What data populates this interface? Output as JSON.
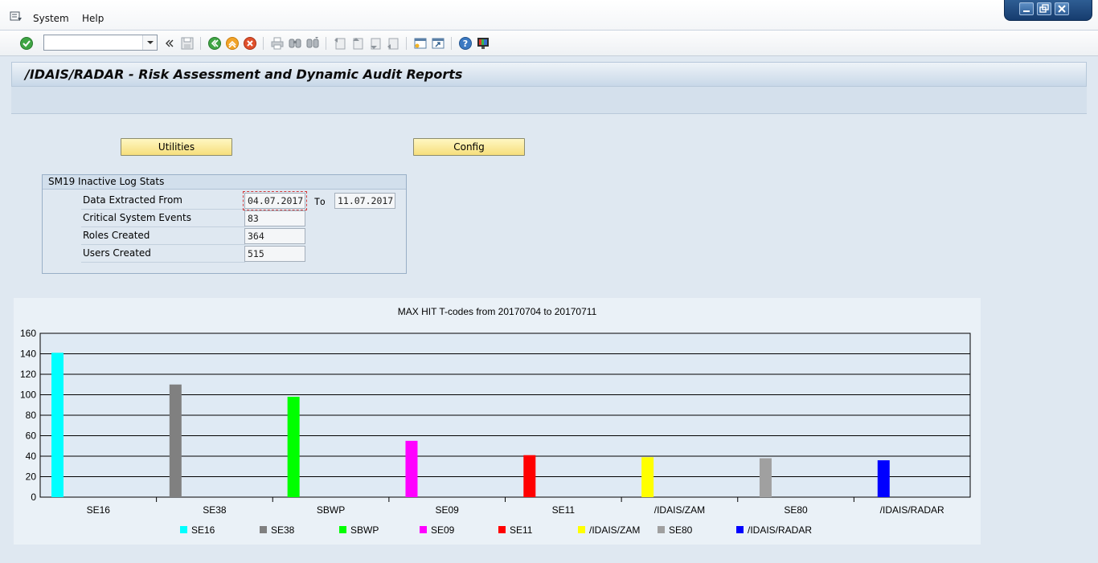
{
  "menubar": {
    "items": [
      "System",
      "Help"
    ]
  },
  "toolbar": {
    "command_field_value": "",
    "icons": [
      "enter-icon",
      "save-icon",
      "back-icon",
      "exit-icon",
      "cancel-icon",
      "print-icon",
      "find-icon",
      "find-next-icon",
      "first-page-icon",
      "previous-page-icon",
      "next-page-icon",
      "last-page-icon",
      "create-session-icon",
      "shortcut-icon",
      "help-icon",
      "layout-icon"
    ]
  },
  "header": {
    "title": "/IDAIS/RADAR - Risk Assessment and Dynamic Audit Reports"
  },
  "main": {
    "buttons": {
      "utilities": "Utilities",
      "config": "Config"
    },
    "stats": {
      "title": "SM19 Inactive Log Stats",
      "rows": [
        {
          "label": "Data Extracted From",
          "value": "04.07.2017"
        },
        {
          "label": "Critical System Events",
          "value": "83"
        },
        {
          "label": "Roles Created",
          "value": "364"
        },
        {
          "label": "Users Created",
          "value": "515"
        }
      ],
      "to_label": "To",
      "to_value": "11.07.2017"
    }
  },
  "colors": {
    "button_bg": "#f6de7c",
    "title_bar": "#c8d8e8",
    "background": "#dfe8f1"
  },
  "chart_data": {
    "type": "bar",
    "title": "MAX HIT T-codes from 20170704 to 20170711",
    "categories": [
      "SE16",
      "SE38",
      "SBWP",
      "SE09",
      "SE11",
      "/IDAIS/ZAM",
      "SE80",
      "/IDAIS/RADAR"
    ],
    "values": [
      141,
      110,
      98,
      55,
      41,
      39,
      38,
      36
    ],
    "colors": [
      "#00ffff",
      "#808080",
      "#00ff00",
      "#ff00ff",
      "#ff0000",
      "#ffff00",
      "#a0a0a0",
      "#0000ff"
    ],
    "ylim": [
      0,
      160
    ],
    "yticks": [
      0,
      20,
      40,
      60,
      80,
      100,
      120,
      140,
      160
    ],
    "grid": true,
    "legend": "bottom"
  }
}
